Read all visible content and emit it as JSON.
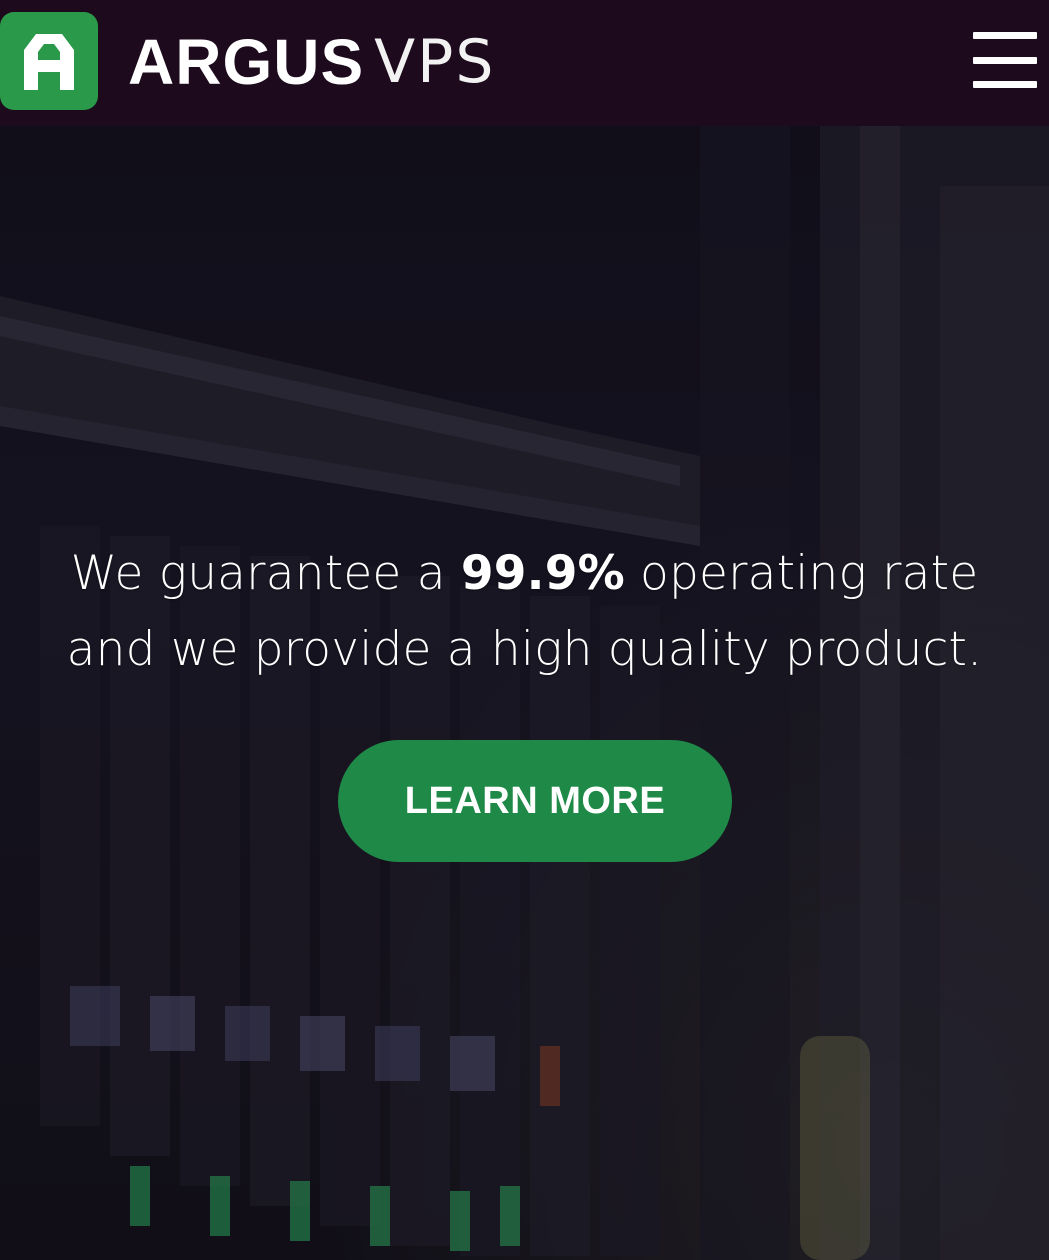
{
  "header": {
    "logo_icon": "argus-a-logo-icon",
    "brand_strong": "ARGUS",
    "brand_light": "VPS",
    "menu_icon": "hamburger-menu-icon"
  },
  "hero": {
    "tagline_part1": "We guarantee a ",
    "tagline_highlight": "99.9%",
    "tagline_part2": " operating rate and we provide a high quality product.",
    "cta_label": "LEARN MORE"
  },
  "colors": {
    "header_bg": "#1d0a1c",
    "logo_green": "#2a9a4a",
    "cta_green": "#1f8a47",
    "text_white": "#ffffff"
  }
}
